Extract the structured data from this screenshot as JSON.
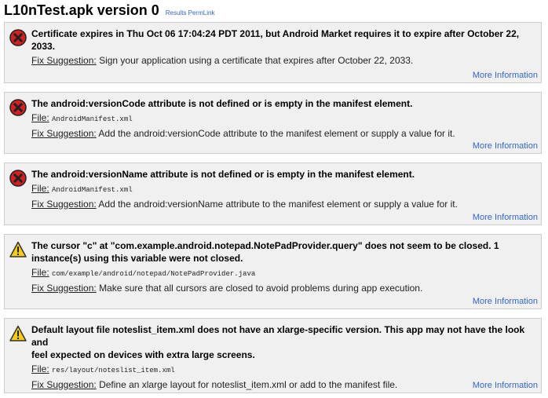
{
  "header": {
    "title": "L10nTest.apk version 0",
    "permlink": "Results PermLink"
  },
  "labels": {
    "file": "File:",
    "fix": "Fix Suggestion:",
    "more_info": "More Information"
  },
  "colors": {
    "error": "#d42020",
    "warning": "#f5cc1a",
    "link": "#3366cc",
    "panel": "#f0f0f0",
    "panel_border": "#cccccc"
  },
  "issues": [
    {
      "severity": "error",
      "icon": "error-x-icon",
      "title_line1": "Certificate expires in Thu Oct 06 17:04:24 PDT 2011, but Android Market requires it to expire after October 22,",
      "title_line2": "2033.",
      "fix": "Sign your application using a certificate that expires after October 22, 2033."
    },
    {
      "severity": "error",
      "icon": "error-x-icon",
      "title_line1": "The android:versionCode attribute is not defined or is empty in the manifest element.",
      "file": "AndroidManifest.xml",
      "fix": "Add the android:versionCode attribute to the manifest element or supply a value for it."
    },
    {
      "severity": "error",
      "icon": "error-x-icon",
      "title_line1": "The android:versionName attribute is not defined or is empty in the manifest element.",
      "file": "AndroidManifest.xml",
      "fix": "Add the android:versionName attribute to the manifest element or supply a value for it."
    },
    {
      "severity": "warning",
      "icon": "warning-triangle-icon",
      "title_line1": "The cursor \"c\" at \"com.example.android.notepad.NotePadProvider.query\" does not seem to be closed. 1",
      "title_line2": "instance(s) using this variable were not closed.",
      "file": "com/example/android/notepad/NotePadProvider.java",
      "fix": "Make sure that all cursors are closed to avoid problems during app execution."
    },
    {
      "severity": "warning",
      "icon": "warning-triangle-icon",
      "title_line1": "Default layout file noteslist_item.xml does not have an xlarge-specific version. This app may not have the look and",
      "title_line2": "feel expected on devices with extra large screens.",
      "file": "res/layout/noteslist_item.xml",
      "fix": "Define an xlarge layout for noteslist_item.xml or add to the manifest file."
    }
  ]
}
